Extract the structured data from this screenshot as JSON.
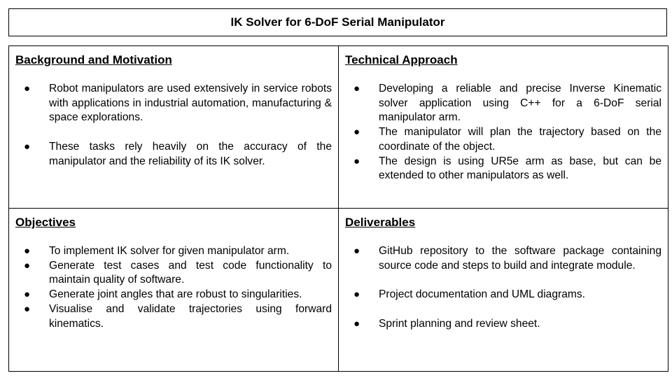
{
  "title": "IK Solver for 6-DoF Serial Manipulator",
  "sections": {
    "background": {
      "heading": "Background and Motivation",
      "items": [
        "Robot manipulators are used extensively in service robots with applications in industrial automation, manufacturing & space explorations.",
        "These tasks rely heavily on the accuracy of the manipulator and the reliability of its IK solver."
      ]
    },
    "technical": {
      "heading": "Technical Approach",
      "items": [
        "Developing a reliable and precise Inverse Kinematic solver application using C++ for a 6-DoF serial manipulator arm.",
        "The manipulator will plan the trajectory based on the coordinate of the object.",
        "The design is using UR5e arm as base, but can be extended to other manipulators as well."
      ]
    },
    "objectives": {
      "heading": "Objectives",
      "items": [
        "To implement IK solver for given manipulator arm.",
        "Generate test cases and test code functionality to maintain quality of software.",
        "Generate joint angles that are robust to singularities.",
        "Visualise and validate trajectories using forward kinematics."
      ]
    },
    "deliverables": {
      "heading": "Deliverables",
      "items": [
        "GitHub repository to the software package containing source code and steps to build and integrate module.",
        "Project documentation and UML diagrams.",
        "Sprint planning and review sheet."
      ]
    }
  },
  "bullet_glyph": "●"
}
